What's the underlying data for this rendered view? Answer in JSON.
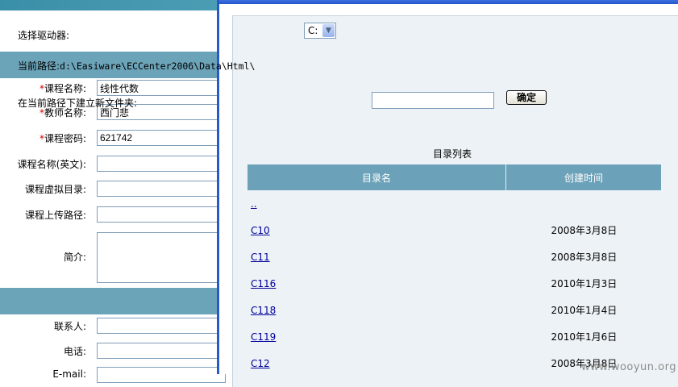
{
  "form": {
    "fields": [
      {
        "label": "课程名称:",
        "required": true,
        "value": "线性代数"
      },
      {
        "label": "教师名称:",
        "required": true,
        "value": "西门悲"
      },
      {
        "label": "课程密码:",
        "required": true,
        "value": "621742"
      },
      {
        "label": "课程名称(英文):",
        "required": false,
        "value": ""
      },
      {
        "label": "课程虚拟目录:",
        "required": false,
        "value": ""
      },
      {
        "label": "课程上传路径:",
        "required": false,
        "value": ""
      }
    ],
    "intro_label": "简介:",
    "contact_fields": [
      {
        "label": "联系人:",
        "value": ""
      },
      {
        "label": "电话:",
        "value": ""
      },
      {
        "label": "E-mail:",
        "value": ""
      }
    ],
    "required_mark": "*"
  },
  "popup": {
    "drive_label": "选择驱动器:",
    "drive_value": "C:",
    "current_path_label": "当前路径:",
    "current_path": "d:\\Easiware\\ECCenter2006\\Data\\Html\\",
    "new_folder_label": "在当前路径下建立新文件夹:",
    "new_folder_value": "",
    "ok_button": "确定",
    "list_title": "目录列表",
    "columns": [
      "目录名",
      "创建时间"
    ],
    "rows": [
      {
        "name": "..",
        "time": ""
      },
      {
        "name": "C10",
        "time": "2008年3月8日"
      },
      {
        "name": "C11",
        "time": "2008年3月8日"
      },
      {
        "name": "C116",
        "time": "2010年1月3日"
      },
      {
        "name": "C118",
        "time": "2010年1月4日"
      },
      {
        "name": "C119",
        "time": "2010年1月6日"
      },
      {
        "name": "C12",
        "time": "2008年3月8日"
      }
    ]
  },
  "watermark": "www.wooyun.org",
  "colors": {
    "header_bar": "#6ba3b8",
    "table_header": "#6ca2b9",
    "popup_bg": "#edf2f6",
    "window_border": "#2a5ac8",
    "link": "#00009c",
    "required": "#cc0000"
  }
}
